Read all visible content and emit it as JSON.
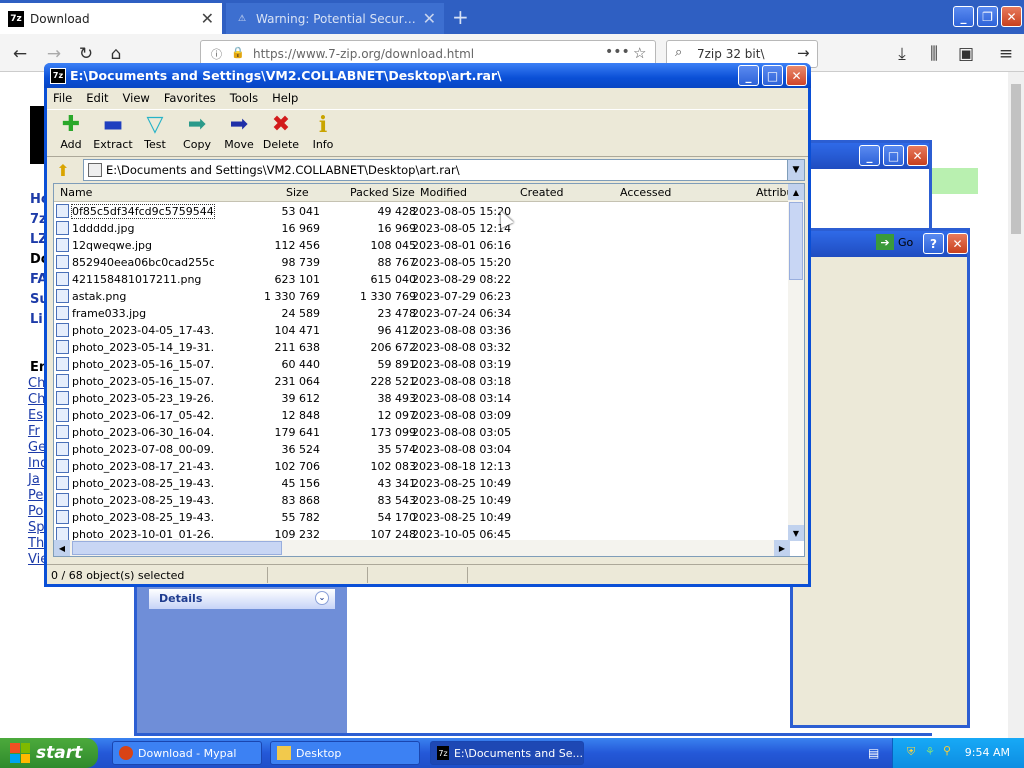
{
  "browser": {
    "tabs": [
      {
        "title": "Download",
        "active": true
      },
      {
        "title": "Warning: Potential Security Risk Ahead",
        "active": false
      }
    ],
    "url": "https://www.7-zip.org/download.html",
    "search_query": "7zip 32 bit\\"
  },
  "page": {
    "nav_links": [
      "Ho",
      "7z",
      "LZ",
      "Do",
      "FA",
      "Su",
      "Li"
    ],
    "section_heading": "En",
    "side_links": [
      "Ch",
      "Ch",
      "Es",
      "Fr",
      "Ge",
      "Ind",
      "Ja",
      "Pe",
      "Po",
      "Sp",
      "Th",
      "Vie"
    ]
  },
  "background_window": {
    "details_label": "Details",
    "go_label": "Go"
  },
  "zip": {
    "title": "E:\\Documents and Settings\\VM2.COLLABNET\\Desktop\\art.rar\\",
    "menu": [
      "File",
      "Edit",
      "View",
      "Favorites",
      "Tools",
      "Help"
    ],
    "toolbar": [
      {
        "label": "Add",
        "icon": "add-icon",
        "color": "#2aa82a"
      },
      {
        "label": "Extract",
        "icon": "extract-icon",
        "color": "#1f3fbf"
      },
      {
        "label": "Test",
        "icon": "test-icon",
        "color": "#27b3c7"
      },
      {
        "label": "Copy",
        "icon": "copy-icon",
        "color": "#2a9a8a"
      },
      {
        "label": "Move",
        "icon": "move-icon",
        "color": "#1f2fa8"
      },
      {
        "label": "Delete",
        "icon": "delete-icon",
        "color": "#d21b1b"
      },
      {
        "label": "Info",
        "icon": "info-icon",
        "color": "#c9a400"
      }
    ],
    "address": "E:\\Documents and Settings\\VM2.COLLABNET\\Desktop\\art.rar\\",
    "columns": [
      "Name",
      "Size",
      "Packed Size",
      "Modified",
      "Created",
      "Accessed",
      "Attribu"
    ],
    "files": [
      {
        "name": "0f85c5df34fcd9c5759544...",
        "size": "53 041",
        "packed": "49 428",
        "modified": "2023-08-05 15:20"
      },
      {
        "name": "1ddddd.jpg",
        "size": "16 969",
        "packed": "16 969",
        "modified": "2023-08-05 12:14"
      },
      {
        "name": "12qweqwe.jpg",
        "size": "112 456",
        "packed": "108 045",
        "modified": "2023-08-01 06:16"
      },
      {
        "name": "852940eea06bc0cad255c...",
        "size": "98 739",
        "packed": "88 767",
        "modified": "2023-08-05 15:20"
      },
      {
        "name": "421158481017211.png",
        "size": "623 101",
        "packed": "615 040",
        "modified": "2023-08-29 08:22"
      },
      {
        "name": "astak.png",
        "size": "1 330 769",
        "packed": "1 330 769",
        "modified": "2023-07-29 06:23"
      },
      {
        "name": "frame033.jpg",
        "size": "24 589",
        "packed": "23 478",
        "modified": "2023-07-24 06:34"
      },
      {
        "name": "photo_2023-04-05_17-43...",
        "size": "104 471",
        "packed": "96 412",
        "modified": "2023-08-08 03:36"
      },
      {
        "name": "photo_2023-05-14_19-31...",
        "size": "211 638",
        "packed": "206 672",
        "modified": "2023-08-08 03:32"
      },
      {
        "name": "photo_2023-05-16_15-07...",
        "size": "60 440",
        "packed": "59 891",
        "modified": "2023-08-08 03:19"
      },
      {
        "name": "photo_2023-05-16_15-07...",
        "size": "231 064",
        "packed": "228 521",
        "modified": "2023-08-08 03:18"
      },
      {
        "name": "photo_2023-05-23_19-26...",
        "size": "39 612",
        "packed": "38 493",
        "modified": "2023-08-08 03:14"
      },
      {
        "name": "photo_2023-06-17_05-42...",
        "size": "12 848",
        "packed": "12 097",
        "modified": "2023-08-08 03:09"
      },
      {
        "name": "photo_2023-06-30_16-04...",
        "size": "179 641",
        "packed": "173 099",
        "modified": "2023-08-08 03:05"
      },
      {
        "name": "photo_2023-07-08_00-09...",
        "size": "36 524",
        "packed": "35 574",
        "modified": "2023-08-08 03:04"
      },
      {
        "name": "photo_2023-08-17_21-43...",
        "size": "102 706",
        "packed": "102 083",
        "modified": "2023-08-18 12:13"
      },
      {
        "name": "photo_2023-08-25_19-43...",
        "size": "45 156",
        "packed": "43 341",
        "modified": "2023-08-25 10:49"
      },
      {
        "name": "photo_2023-08-25_19-43...",
        "size": "83 868",
        "packed": "83 543",
        "modified": "2023-08-25 10:49"
      },
      {
        "name": "photo_2023-08-25_19-43...",
        "size": "55 782",
        "packed": "54 170",
        "modified": "2023-08-25 10:49"
      },
      {
        "name": "photo_2023-10-01_01-26...",
        "size": "109 232",
        "packed": "107 248",
        "modified": "2023-10-05 06:45"
      }
    ],
    "status": "0 / 68 object(s) selected"
  },
  "taskbar": {
    "start_label": "start",
    "items": [
      {
        "label": "Download - Mypal",
        "icon": "mypal-icon"
      },
      {
        "label": "Desktop",
        "icon": "folder-icon"
      },
      {
        "label": "E:\\Documents and Se...",
        "icon": "7zip-icon"
      }
    ],
    "clock": "9:54 AM"
  }
}
